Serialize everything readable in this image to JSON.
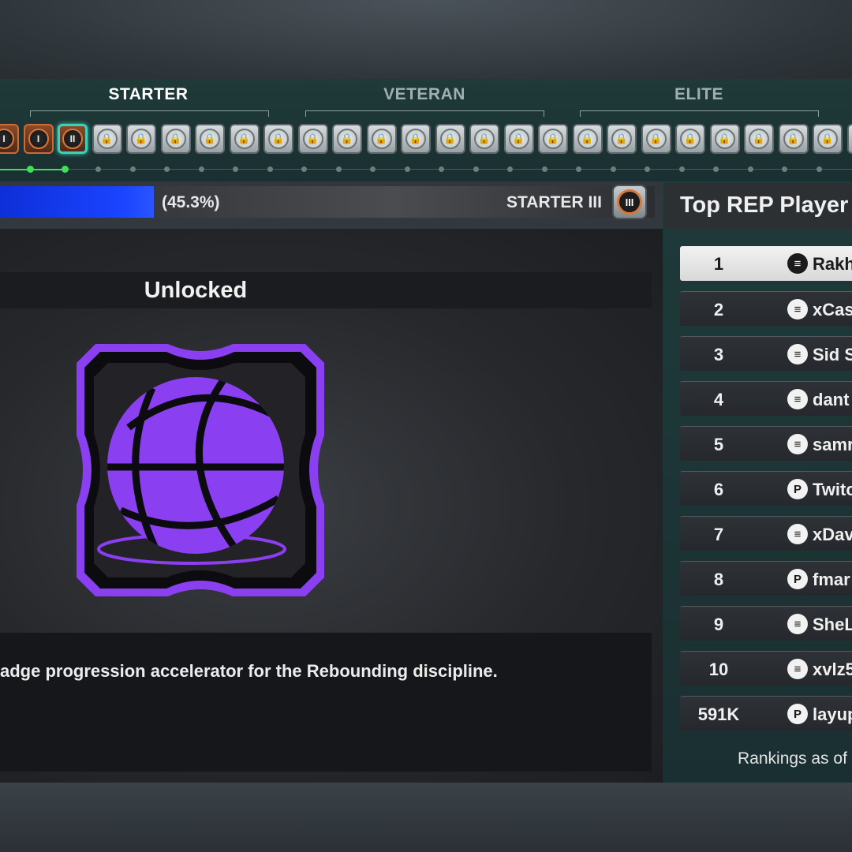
{
  "tiers": [
    {
      "label": "STARTER"
    },
    {
      "label": "VETERAN"
    },
    {
      "label": "ELITE"
    }
  ],
  "progress": {
    "percent_text": "(45.3%)",
    "fraction": 0.453,
    "tier_text": "STARTER III",
    "tier_numeral": "III"
  },
  "badges": {
    "selected_numeral": "II",
    "unlocked_numeral": "I",
    "lock_glyph": "🔒"
  },
  "main": {
    "status": "Unlocked",
    "description": "adge progression accelerator for the Rebounding discipline.",
    "badge_color": "#8a3ff0"
  },
  "leaderboard": {
    "title": "Top REP Player",
    "rows": [
      {
        "rank": "1",
        "platform": "cross",
        "name": "Rakh"
      },
      {
        "rank": "2",
        "platform": "cross",
        "name": "xCas"
      },
      {
        "rank": "3",
        "platform": "cross",
        "name": "Sid S"
      },
      {
        "rank": "4",
        "platform": "cross",
        "name": "dant"
      },
      {
        "rank": "5",
        "platform": "cross",
        "name": "samr"
      },
      {
        "rank": "6",
        "platform": "playstation",
        "name": "Twitc"
      },
      {
        "rank": "7",
        "platform": "cross",
        "name": "xDav"
      },
      {
        "rank": "8",
        "platform": "playstation",
        "name": "fmar"
      },
      {
        "rank": "9",
        "platform": "cross",
        "name": "SheL"
      },
      {
        "rank": "10",
        "platform": "cross",
        "name": "xvlz5"
      },
      {
        "rank": "591K",
        "platform": "playstation",
        "name": "layup"
      }
    ],
    "footer": "Rankings as of"
  },
  "colors": {
    "progress_blue": "#1b44ff",
    "track_green": "#3ee056",
    "selection_teal": "#3fd0b8",
    "bronze_ring": "#d8773c"
  }
}
